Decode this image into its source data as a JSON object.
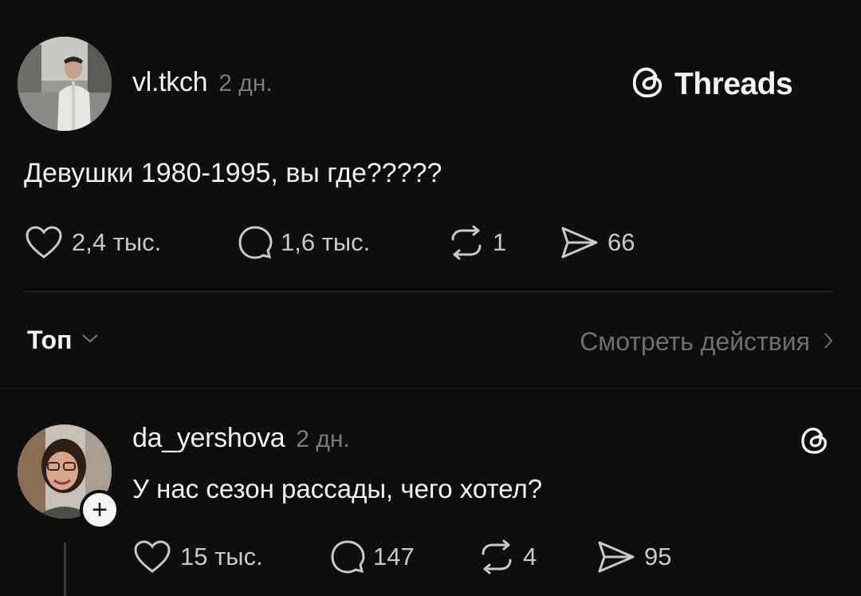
{
  "post": {
    "username": "vl.tkch",
    "time": "2 дн.",
    "text": "Девушки 1980-1995, вы где?????",
    "likes": "2,4 тыс.",
    "comments": "1,6 тыс.",
    "reposts": "1",
    "shares": "66"
  },
  "brand": {
    "label": "Threads"
  },
  "filter": {
    "sort_label": "Топ",
    "view_activity_label": "Смотреть действия"
  },
  "reply": {
    "username": "da_yershova",
    "time": "2 дн.",
    "text": "У нас сезон рассады, чего хотел?",
    "likes": "15 тыс.",
    "comments": "147",
    "reposts": "4",
    "shares": "95"
  },
  "colors": {
    "background": "#0f0e0f",
    "text": "#f2f2f2",
    "muted": "#7c7c7c"
  }
}
